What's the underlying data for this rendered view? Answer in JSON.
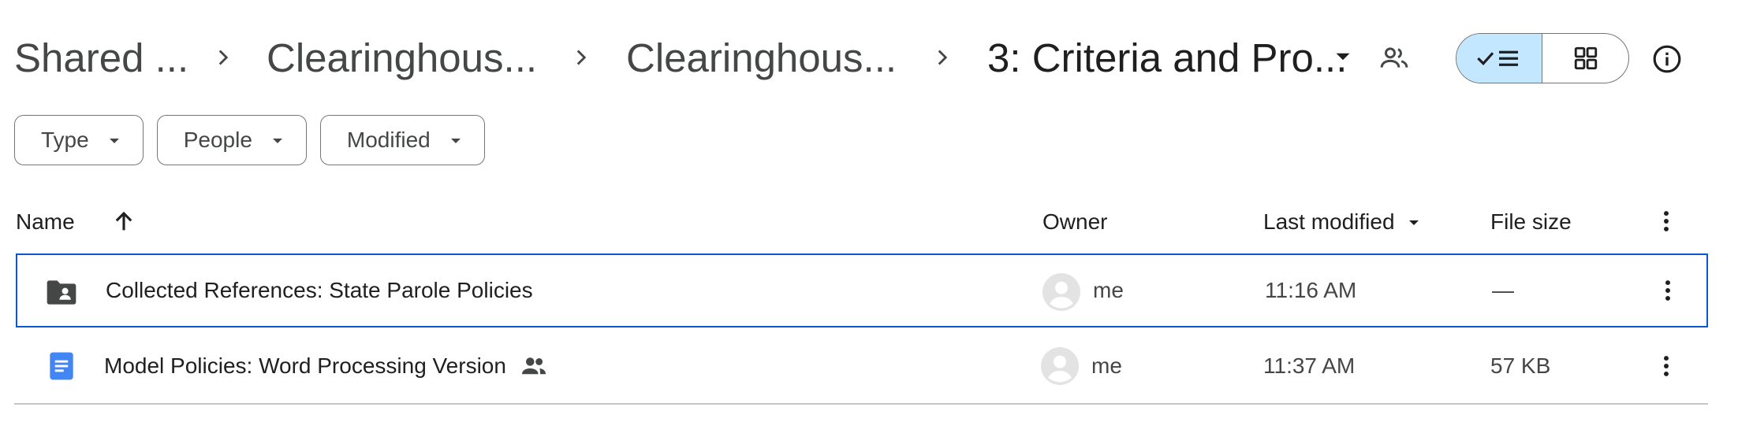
{
  "breadcrumb": {
    "items": [
      {
        "label": "Shared ..."
      },
      {
        "label": "Clearinghous..."
      },
      {
        "label": "Clearinghous..."
      },
      {
        "label": "3: Criteria and Pro..."
      }
    ]
  },
  "icons": {
    "separator": "chevron-right-icon",
    "dropdown": "arrow-drop-down-icon",
    "shared_folder": "people-icon",
    "list_view": "check-list-icon",
    "grid_view": "grid-icon",
    "info": "info-icon"
  },
  "view_toggle": {
    "active": "list"
  },
  "filters": [
    {
      "label": "Type"
    },
    {
      "label": "People"
    },
    {
      "label": "Modified"
    }
  ],
  "table": {
    "columns": {
      "name": "Name",
      "owner": "Owner",
      "last_modified": "Last modified",
      "file_size": "File size"
    },
    "rows": [
      {
        "name": "Collected References: State Parole Policies",
        "type": "shared-folder",
        "owner": "me",
        "modified": "11:16 AM",
        "size": "—",
        "selected": true,
        "shared": false
      },
      {
        "name": "Model Policies: Word Processing Version",
        "type": "google-doc",
        "owner": "me",
        "modified": "11:37 AM",
        "size": "57 KB",
        "selected": false,
        "shared": true
      }
    ]
  },
  "colors": {
    "accent": "#0b57d0",
    "toggle_active": "#c2e7ff",
    "doc_blue": "#4285f4",
    "text_primary": "#1f1f1f",
    "text_secondary": "#444746"
  }
}
